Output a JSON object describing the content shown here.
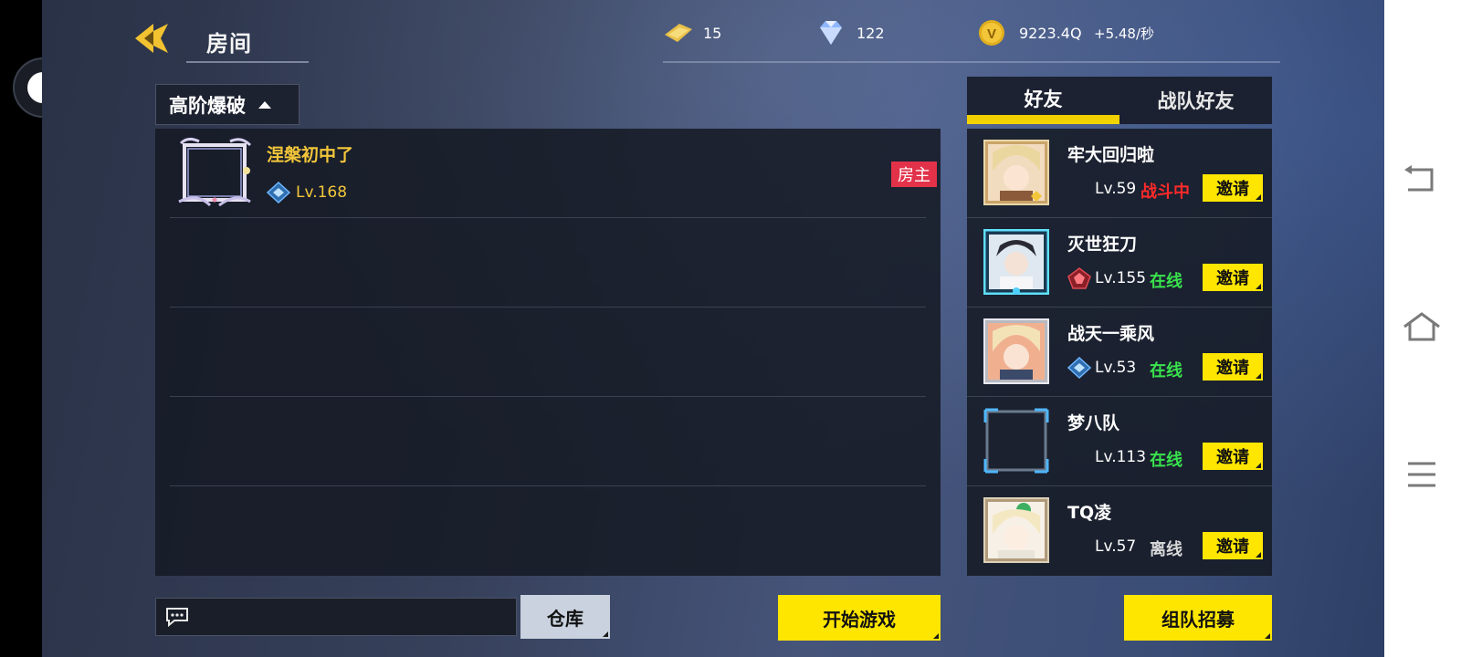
{
  "header": {
    "title": "房间",
    "resources": {
      "tickets": "15",
      "diamonds": "122",
      "gold": "9223.4Q",
      "gold_rate": "+5.48/秒"
    }
  },
  "room": {
    "mode_label": "高阶爆破",
    "players": [
      {
        "name": "涅槃初中了",
        "level": "Lv.168",
        "badge": "房主"
      }
    ]
  },
  "friends": {
    "tabs": [
      "好友",
      "战队好友"
    ],
    "list": [
      {
        "name": "牢大回归啦",
        "level": "Lv.59",
        "status": "战斗中",
        "invite": "邀请"
      },
      {
        "name": "灭世狂刀",
        "level": "Lv.155",
        "status": "在线",
        "invite": "邀请"
      },
      {
        "name": "战天一乘风",
        "level": "Lv.53",
        "status": "在线",
        "invite": "邀请"
      },
      {
        "name": "梦八队",
        "level": "Lv.113",
        "status": "在线",
        "invite": "邀请"
      },
      {
        "name": "TQ凌",
        "level": "Lv.57",
        "status": "离线",
        "invite": "邀请"
      }
    ]
  },
  "bottom": {
    "chat_placeholder": "",
    "warehouse_label": "仓库",
    "start_label": "开始游戏",
    "recruit_label": "组队招募"
  },
  "colors": {
    "accent_yellow": "#ffe600",
    "gold_text": "#f3c63a",
    "owner_red": "#e2324a",
    "online_green": "#39e24d",
    "battle_red": "#ff2a2a"
  },
  "icons": [
    "back-arrow-icon",
    "ticket-icon",
    "diamond-icon",
    "gold-coin-icon",
    "caret-up-icon",
    "rank-icon",
    "chat-icon",
    "nav-back-icon",
    "nav-home-icon",
    "nav-menu-icon"
  ]
}
